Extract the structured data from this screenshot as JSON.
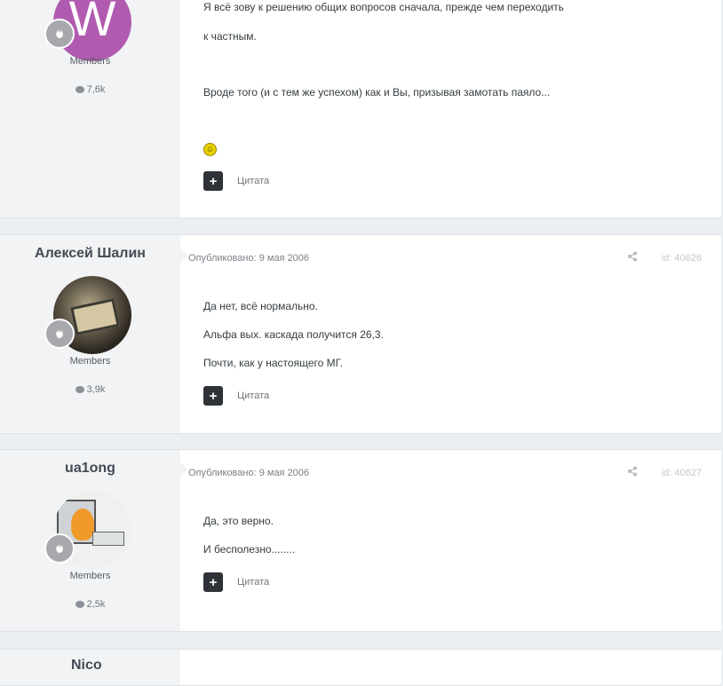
{
  "posts": [
    {
      "author": "",
      "avatar_letter": "W",
      "avatar_color": "#b15bb0",
      "group": "Members",
      "count": "7,6k",
      "meta": "",
      "post_id": "",
      "lines": [
        "Я всё зову к решению общих вопросов сначала, прежде чем переходить",
        "к частным.",
        "Вроде того (и с тем же успехом) как и Вы, призывая замотать паяло..."
      ],
      "quote_label": "Цитата"
    },
    {
      "author": "Алексей Шалин",
      "group": "Members",
      "count": "3,9k",
      "meta": "Опубликовано: 9 мая 2006",
      "post_id": "id: 40626",
      "lines": [
        "Да нет, всё нормально.",
        "Альфа вых. каскада получится 26,3.",
        "Почти, как у настоящего МГ."
      ],
      "quote_label": "Цитата"
    },
    {
      "author": "ua1ong",
      "group": "Members",
      "count": "2,5k",
      "meta": "Опубликовано: 9 мая 2006",
      "post_id": "id: 40627",
      "lines": [
        "Да, это верно.",
        "И бесполезно........"
      ],
      "quote_label": "Цитата"
    }
  ],
  "next_author_partial": "Nico",
  "icons": {
    "badge": "hand-icon",
    "count": "comment-bubble-icon",
    "share": "share-icon",
    "quote": "plus-icon"
  }
}
